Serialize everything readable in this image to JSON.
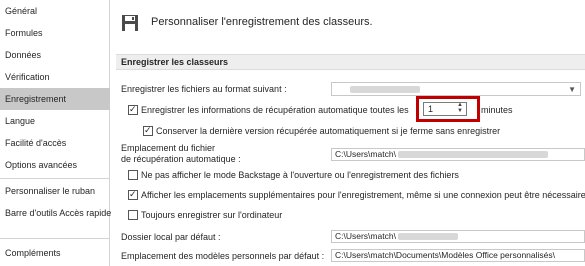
{
  "sidebar": {
    "items": [
      {
        "label": "Général"
      },
      {
        "label": "Formules"
      },
      {
        "label": "Données"
      },
      {
        "label": "Vérification"
      },
      {
        "label": "Enregistrement"
      },
      {
        "label": "Langue"
      },
      {
        "label": "Facilité d'accès"
      },
      {
        "label": "Options avancées"
      },
      {
        "label": "Personnaliser le ruban"
      },
      {
        "label": "Barre d'outils Accès rapide"
      },
      {
        "label": "Compléments"
      }
    ],
    "active_index": 4
  },
  "header": {
    "title": "Personnaliser l'enregistrement des classeurs.",
    "icon": "save-icon"
  },
  "section": {
    "title": "Enregistrer les classeurs"
  },
  "save_format": {
    "label": "Enregistrer les fichiers au format suivant :",
    "value": ""
  },
  "autorecover": {
    "checked": true,
    "label": "Enregistrer les informations de récupération automatique toutes les",
    "minutes_value": "1",
    "minutes_label": "minutes"
  },
  "keep_last": {
    "checked": true,
    "label": "Conserver la dernière version récupérée automatiquement si je ferme sans enregistrer"
  },
  "autorecover_location": {
    "label_line1": "Emplacement du fichier",
    "label_line2": "de récupération automatique :",
    "value": "C:\\Users\\match\\"
  },
  "no_backstage": {
    "checked": false,
    "label": "Ne pas afficher le mode Backstage à l'ouverture ou l'enregistrement des fichiers"
  },
  "show_extra_places": {
    "checked": true,
    "label": "Afficher les emplacements supplémentaires pour l'enregistrement, même si une connexion peut être nécessaire"
  },
  "always_save_computer": {
    "checked": false,
    "label": "Toujours enregistrer sur l'ordinateur"
  },
  "local_folder": {
    "label": "Dossier local par défaut :",
    "value": "C:\\Users\\match\\"
  },
  "templates_location": {
    "label": "Emplacement des modèles personnels par défaut :",
    "value": "C:\\Users\\match\\Documents\\Modèles Office personnalisés\\"
  },
  "colors": {
    "highlight": "#c00000",
    "active_nav": "#c8c8c8",
    "section_bg": "#eeeeee"
  }
}
